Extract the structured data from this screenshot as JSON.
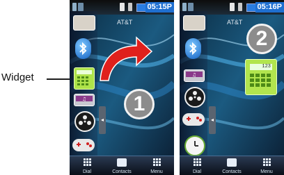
{
  "callout": {
    "label": "Widget"
  },
  "phones": [
    {
      "time": "05:15P",
      "carrier": "AT&T",
      "step_number": "1",
      "dock": {
        "dial": "Dial",
        "contacts": "Contacts",
        "menu": "Menu"
      }
    },
    {
      "time": "05:16P",
      "carrier": "AT&T",
      "step_number": "2",
      "calculator_display": "123",
      "dock": {
        "dial": "Dial",
        "contacts": "Contacts",
        "menu": "Menu"
      }
    }
  ],
  "colors": {
    "arrow": "#e0201c",
    "calculator": "#aee34a",
    "status_time_bg": "#1f6fd0"
  }
}
